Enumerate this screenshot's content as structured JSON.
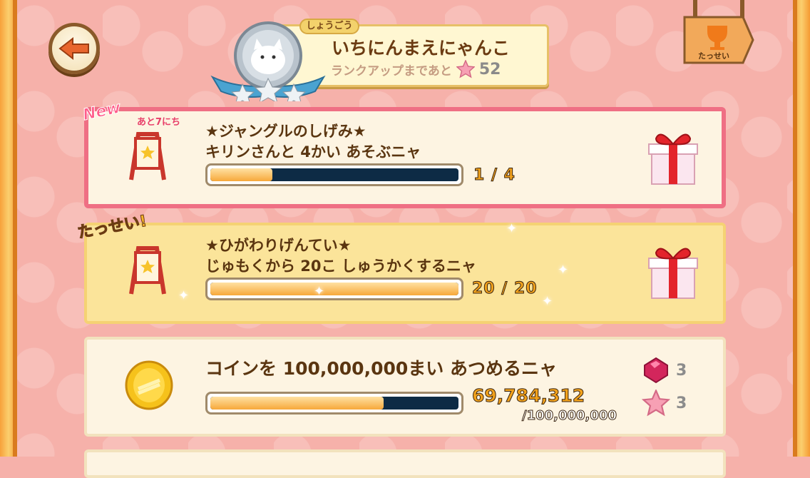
{
  "header": {
    "title_tab": "しょうごう",
    "title_name": "いちにんまえにゃんこ",
    "rankup_label": "ランクアップまであと",
    "rankup_count": "52",
    "achievements_label": "たっせい"
  },
  "missions": [
    {
      "badge": "New",
      "days_left": "あと7にち",
      "title_line1": "★ジャングルのしげみ★",
      "title_line2": "キリンさんと 4かい あそぶニャ",
      "progress_text": "1 / 4",
      "progress_fraction": 0.25
    },
    {
      "badge": "たっせい!",
      "title_line1": "★ひがわりげんてい★",
      "title_line2": "じゅもくから 20こ しゅうかくするニャ",
      "progress_text": "20 / 20",
      "progress_fraction": 1.0
    },
    {
      "title_line1": "コインを 100,000,000まい あつめるニャ",
      "progress_current": "69,784,312",
      "progress_goal": "/100,000,000",
      "progress_fraction": 0.698,
      "rewards": [
        {
          "icon": "gem-icon",
          "count": "3"
        },
        {
          "icon": "star-icon",
          "count": "3"
        }
      ]
    }
  ],
  "colors": {
    "background": "#f6b1aa",
    "new_card_border": "#ef6f84",
    "done_card_bg": "#fbe49a",
    "progress_fill": "#f7a83a",
    "progress_track": "#0d2b45",
    "title_text": "#5a3510"
  }
}
